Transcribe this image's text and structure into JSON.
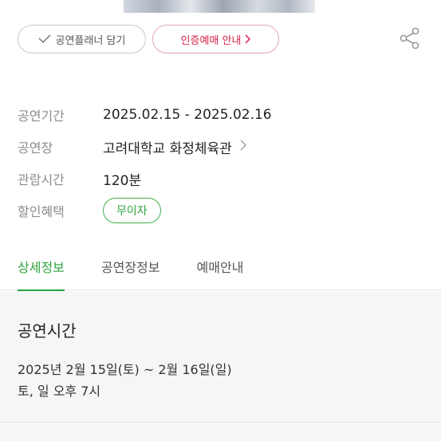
{
  "actions": {
    "wishlist_label": "공연플래너 담기",
    "certification_label": "인증예매 안내",
    "share_icon": "share-icon"
  },
  "info": {
    "rows": [
      {
        "label": "공연기간",
        "value": "2025.02.15 - 2025.02.16"
      },
      {
        "label": "공연장",
        "value": "고려대학교 화정체육관"
      },
      {
        "label": "관람시간",
        "value": "120분"
      },
      {
        "label": "할인혜택",
        "value": "무이자"
      }
    ]
  },
  "tabs": [
    {
      "label": "상세정보",
      "active": true
    },
    {
      "label": "공연장정보",
      "active": false
    },
    {
      "label": "예매안내",
      "active": false
    }
  ],
  "detail": {
    "heading": "공연시간",
    "line1": "2025년 2월 15일(토) ~ 2월 16일(일)",
    "line2": "토, 일 오후 7시"
  },
  "colors": {
    "accent_green": "#2ea23c",
    "accent_pink": "#d6224b"
  }
}
